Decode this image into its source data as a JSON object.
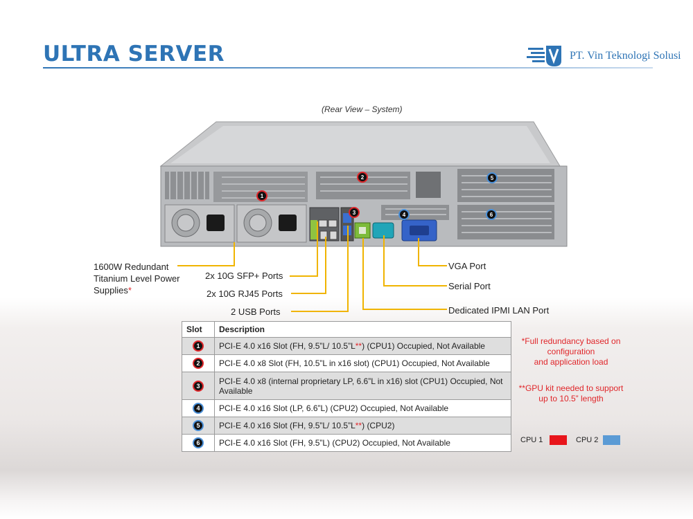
{
  "title": "ULTRA SERVER",
  "logo": {
    "text": "PT. Vin Teknologi Solusi",
    "icon": "company-logo-icon"
  },
  "caption": "(Rear View – System)",
  "callouts": {
    "psu_line1": "1600W Redundant",
    "psu_line2": "Titanium  Level Power",
    "psu_line3": "Supplies",
    "psu_mark": "*",
    "sfp": "2x 10G SFP+ Ports",
    "rj45": "2x 10G RJ45 Ports",
    "usb": "2 USB Ports",
    "vga": "VGA Port",
    "serial": "Serial Port",
    "ipmi": "Dedicated IPMI  LAN Port"
  },
  "markers": [
    {
      "num": "1",
      "cpu": "cpu1"
    },
    {
      "num": "2",
      "cpu": "cpu1"
    },
    {
      "num": "3",
      "cpu": "cpu1"
    },
    {
      "num": "4",
      "cpu": "cpu2"
    },
    {
      "num": "5",
      "cpu": "cpu2"
    },
    {
      "num": "6",
      "cpu": "cpu2"
    }
  ],
  "table": {
    "headers": {
      "slot": "Slot",
      "description": "Description"
    },
    "rows": [
      {
        "num": "1",
        "cpu": "cpu1",
        "pre": "PCI-E 4.0 x16 Slot (FH, 9.5”L/ 10.5”L",
        "mark": "**",
        "post": ") (CPU1) Occupied, Not Available"
      },
      {
        "num": "2",
        "cpu": "cpu1",
        "pre": "PCI-E 4.0 x8 Slot (FH, 10.5”L in x16 slot) (CPU1) Occupied, Not Available",
        "mark": "",
        "post": ""
      },
      {
        "num": "3",
        "cpu": "cpu1",
        "pre": "PCI-E 4.0 x8 (internal proprietary LP, 6.6”L in x16) slot  (CPU1) Occupied, Not Available",
        "mark": "",
        "post": ""
      },
      {
        "num": "4",
        "cpu": "cpu2",
        "pre": "PCI-E 4.0 x16 Slot (LP, 6.6”L) (CPU2) Occupied, Not Available",
        "mark": "",
        "post": ""
      },
      {
        "num": "5",
        "cpu": "cpu2",
        "pre": "PCI-E 4.0 x16 Slot (FH, 9.5”L/ 10.5”L",
        "mark": "**",
        "post": ") (CPU2)"
      },
      {
        "num": "6",
        "cpu": "cpu2",
        "pre": "PCI-E 4.0 x16 Slot (FH, 9.5”L) (CPU2) Occupied, Not Available",
        "mark": "",
        "post": ""
      }
    ]
  },
  "notes": {
    "n1_line1": "*Full redundancy based on",
    "n1_line2": "configuration",
    "n1_line3": "and application load",
    "n2_line1": "**GPU kit needed to support",
    "n2_line2": "up to 10.5” length"
  },
  "legend": {
    "cpu1_label": "CPU 1",
    "cpu1_color": "#e8151b",
    "cpu2_label": "CPU 2",
    "cpu2_color": "#5b9bd5"
  },
  "colors": {
    "cpu1_ring": "#e0262a",
    "cpu2_ring": "#4a90d9",
    "accent": "#2e74b5",
    "callout_line": "#f0b400"
  }
}
